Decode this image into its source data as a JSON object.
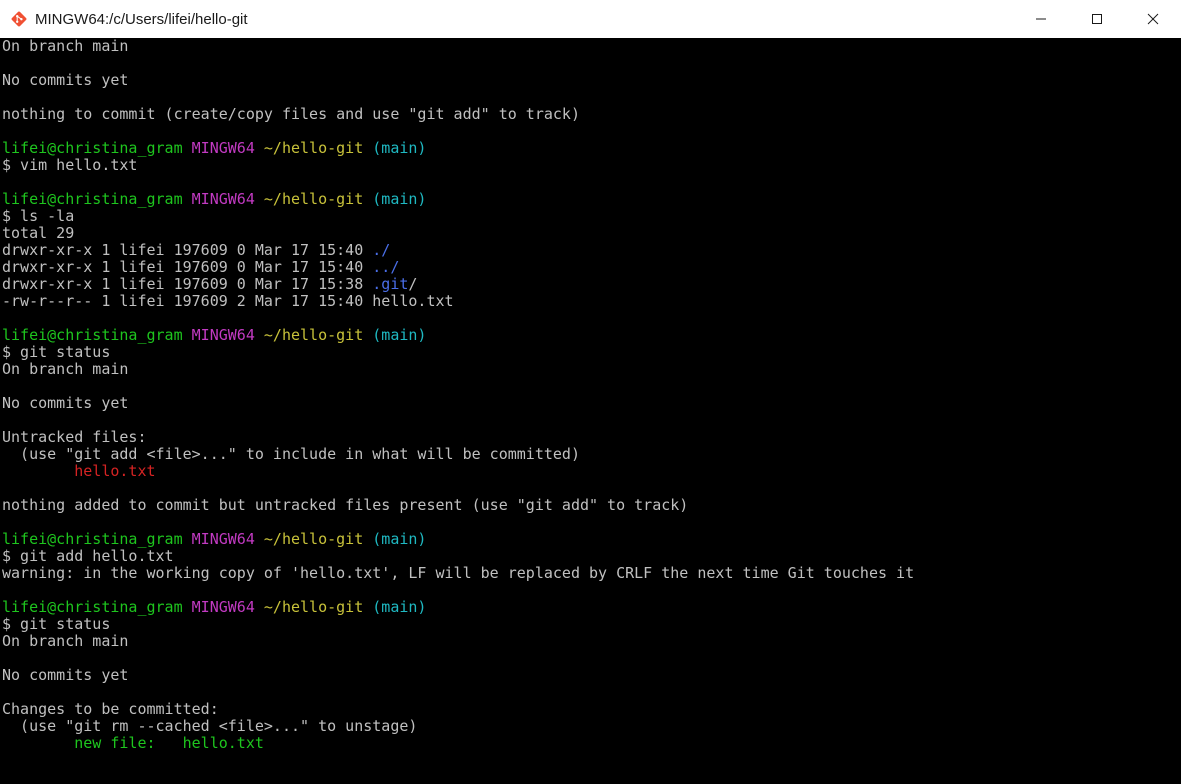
{
  "window": {
    "title": "MINGW64:/c/Users/lifei/hello-git"
  },
  "controls": {
    "minimize_icon": "minimize-icon",
    "maximize_icon": "maximize-icon",
    "close_icon": "close-icon"
  },
  "colors": {
    "background": "#000000",
    "default_text": "#c0c0c0",
    "prompt_user": "#1ec51e",
    "prompt_system": "#c23ac2",
    "prompt_path": "#c8c23a",
    "prompt_branch": "#1fb9c2",
    "directory": "#4a6ee8",
    "untracked": "#d52323",
    "staged": "#1ec51e"
  },
  "terminal": {
    "lines": [
      [
        {
          "t": "On branch main",
          "c": "default"
        }
      ],
      [
        {
          "t": "",
          "c": "default"
        }
      ],
      [
        {
          "t": "No commits yet",
          "c": "default"
        }
      ],
      [
        {
          "t": "",
          "c": "default"
        }
      ],
      [
        {
          "t": "nothing to commit (create/copy files and use \"git add\" to track)",
          "c": "default"
        }
      ],
      [
        {
          "t": "",
          "c": "default"
        }
      ],
      [
        {
          "t": "lifei@christina_gram ",
          "c": "green"
        },
        {
          "t": "MINGW64 ",
          "c": "purple"
        },
        {
          "t": "~/hello-git",
          "c": "yellow"
        },
        {
          "t": " (main)",
          "c": "cyan"
        }
      ],
      [
        {
          "t": "$ vim hello.txt",
          "c": "default"
        }
      ],
      [
        {
          "t": "",
          "c": "default"
        }
      ],
      [
        {
          "t": "lifei@christina_gram ",
          "c": "green"
        },
        {
          "t": "MINGW64 ",
          "c": "purple"
        },
        {
          "t": "~/hello-git",
          "c": "yellow"
        },
        {
          "t": " (main)",
          "c": "cyan"
        }
      ],
      [
        {
          "t": "$ ls -la",
          "c": "default"
        }
      ],
      [
        {
          "t": "total 29",
          "c": "default"
        }
      ],
      [
        {
          "t": "drwxr-xr-x 1 lifei 197609 0 Mar 17 15:40 ",
          "c": "default"
        },
        {
          "t": "./",
          "c": "blue"
        }
      ],
      [
        {
          "t": "drwxr-xr-x 1 lifei 197609 0 Mar 17 15:40 ",
          "c": "default"
        },
        {
          "t": "../",
          "c": "blue"
        }
      ],
      [
        {
          "t": "drwxr-xr-x 1 lifei 197609 0 Mar 17 15:38 ",
          "c": "default"
        },
        {
          "t": ".git",
          "c": "blue"
        },
        {
          "t": "/",
          "c": "default"
        }
      ],
      [
        {
          "t": "-rw-r--r-- 1 lifei 197609 2 Mar 17 15:40 hello.txt",
          "c": "default"
        }
      ],
      [
        {
          "t": "",
          "c": "default"
        }
      ],
      [
        {
          "t": "lifei@christina_gram ",
          "c": "green"
        },
        {
          "t": "MINGW64 ",
          "c": "purple"
        },
        {
          "t": "~/hello-git",
          "c": "yellow"
        },
        {
          "t": " (main)",
          "c": "cyan"
        }
      ],
      [
        {
          "t": "$ git status",
          "c": "default"
        }
      ],
      [
        {
          "t": "On branch main",
          "c": "default"
        }
      ],
      [
        {
          "t": "",
          "c": "default"
        }
      ],
      [
        {
          "t": "No commits yet",
          "c": "default"
        }
      ],
      [
        {
          "t": "",
          "c": "default"
        }
      ],
      [
        {
          "t": "Untracked files:",
          "c": "default"
        }
      ],
      [
        {
          "t": "  (use \"git add <file>...\" to include in what will be committed)",
          "c": "default"
        }
      ],
      [
        {
          "t": "        hello.txt",
          "c": "red"
        }
      ],
      [
        {
          "t": "",
          "c": "default"
        }
      ],
      [
        {
          "t": "nothing added to commit but untracked files present (use \"git add\" to track)",
          "c": "default"
        }
      ],
      [
        {
          "t": "",
          "c": "default"
        }
      ],
      [
        {
          "t": "lifei@christina_gram ",
          "c": "green"
        },
        {
          "t": "MINGW64 ",
          "c": "purple"
        },
        {
          "t": "~/hello-git",
          "c": "yellow"
        },
        {
          "t": " (main)",
          "c": "cyan"
        }
      ],
      [
        {
          "t": "$ git add hello.txt",
          "c": "default"
        }
      ],
      [
        {
          "t": "warning: in the working copy of 'hello.txt', LF will be replaced by CRLF the next time Git touches it",
          "c": "default"
        }
      ],
      [
        {
          "t": "",
          "c": "default"
        }
      ],
      [
        {
          "t": "lifei@christina_gram ",
          "c": "green"
        },
        {
          "t": "MINGW64 ",
          "c": "purple"
        },
        {
          "t": "~/hello-git",
          "c": "yellow"
        },
        {
          "t": " (main)",
          "c": "cyan"
        }
      ],
      [
        {
          "t": "$ git status",
          "c": "default"
        }
      ],
      [
        {
          "t": "On branch main",
          "c": "default"
        }
      ],
      [
        {
          "t": "",
          "c": "default"
        }
      ],
      [
        {
          "t": "No commits yet",
          "c": "default"
        }
      ],
      [
        {
          "t": "",
          "c": "default"
        }
      ],
      [
        {
          "t": "Changes to be committed:",
          "c": "default"
        }
      ],
      [
        {
          "t": "  (use \"git rm --cached <file>...\" to unstage)",
          "c": "default"
        }
      ],
      [
        {
          "t": "        new file:   hello.txt",
          "c": "green"
        }
      ]
    ]
  }
}
